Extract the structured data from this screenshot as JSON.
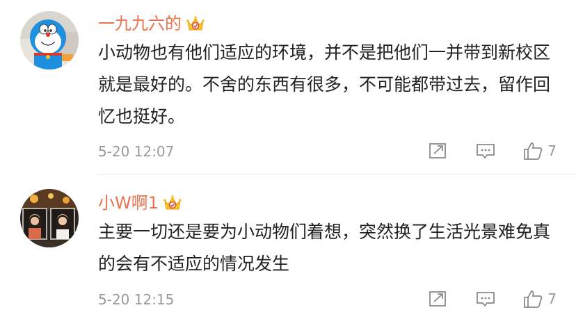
{
  "comments": [
    {
      "username": "一九九六的",
      "text": "小动物也有他们适应的环境，并不是把他们一并带到新校区就是最好的。不舍的东西有很多，不可能都带过去，留作回忆也挺好。",
      "timestamp": "5-20 12:07",
      "like_count": "7",
      "badge_icon": "crown-badge-icon",
      "accent_color": "#eb7350"
    },
    {
      "username": "小W啊1",
      "text": "主要一切还是要为小动物们着想，突然换了生活光景难免真的会有不适应的情况发生",
      "timestamp": "5-20 12:15",
      "like_count": "7",
      "badge_icon": "crown-badge-icon",
      "accent_color": "#eb7350"
    }
  ],
  "icons": [
    "share-icon",
    "comment-icon",
    "like-icon"
  ]
}
